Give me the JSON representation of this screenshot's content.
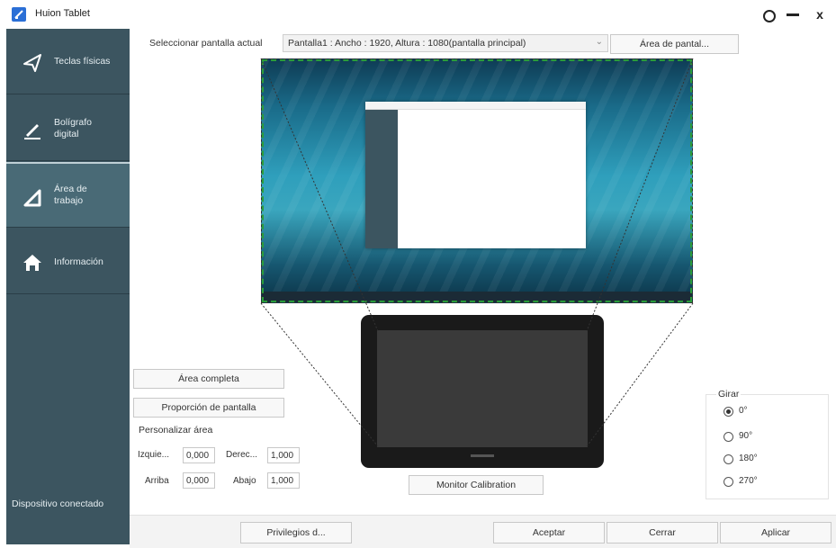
{
  "titlebar": {
    "title": "Huion Tablet",
    "icons": [
      "app-logo-icon",
      "settings-icon",
      "minimize-icon",
      "close-icon"
    ],
    "close_glyph": "x"
  },
  "sidebar": {
    "items": [
      {
        "label": "Teclas físicas",
        "icon": "send-arrow-icon"
      },
      {
        "label": "Bolígrafo digital",
        "icon": "pen-icon"
      },
      {
        "label": "Área de trabajo",
        "icon": "triangle-icon"
      },
      {
        "label": "Información",
        "icon": "home-icon"
      }
    ],
    "status": "Dispositivo conectado"
  },
  "display": {
    "select_label": "Seleccionar pantalla actual",
    "selected": "Pantalla1 : Ancho : 1920, Altura : 1080(pantalla principal)",
    "screen_area_button": "Área de pantal..."
  },
  "area": {
    "full_area_button": "Área completa",
    "screen_ratio_button": "Proporción de pantalla",
    "custom_label": "Personalizar área",
    "left_label": "Izquie...",
    "left_value": "0,000",
    "right_label": "Derec...",
    "right_value": "1,000",
    "top_label": "Arriba",
    "top_value": "0,000",
    "bottom_label": "Abajo",
    "bottom_value": "1,000"
  },
  "monitor_calibration_button": "Monitor Calibration",
  "rotate": {
    "title": "Girar",
    "options": [
      "0°",
      "90°",
      "180°",
      "270°"
    ],
    "selected": "0°"
  },
  "footer": {
    "privileges_button": "Privilegios d...",
    "accept_button": "Aceptar",
    "close_button": "Cerrar",
    "apply_button": "Aplicar"
  },
  "colors": {
    "sidebar": "#3c5560",
    "sidebar_active": "#496a76",
    "screen_border": "#2a9c3a"
  }
}
